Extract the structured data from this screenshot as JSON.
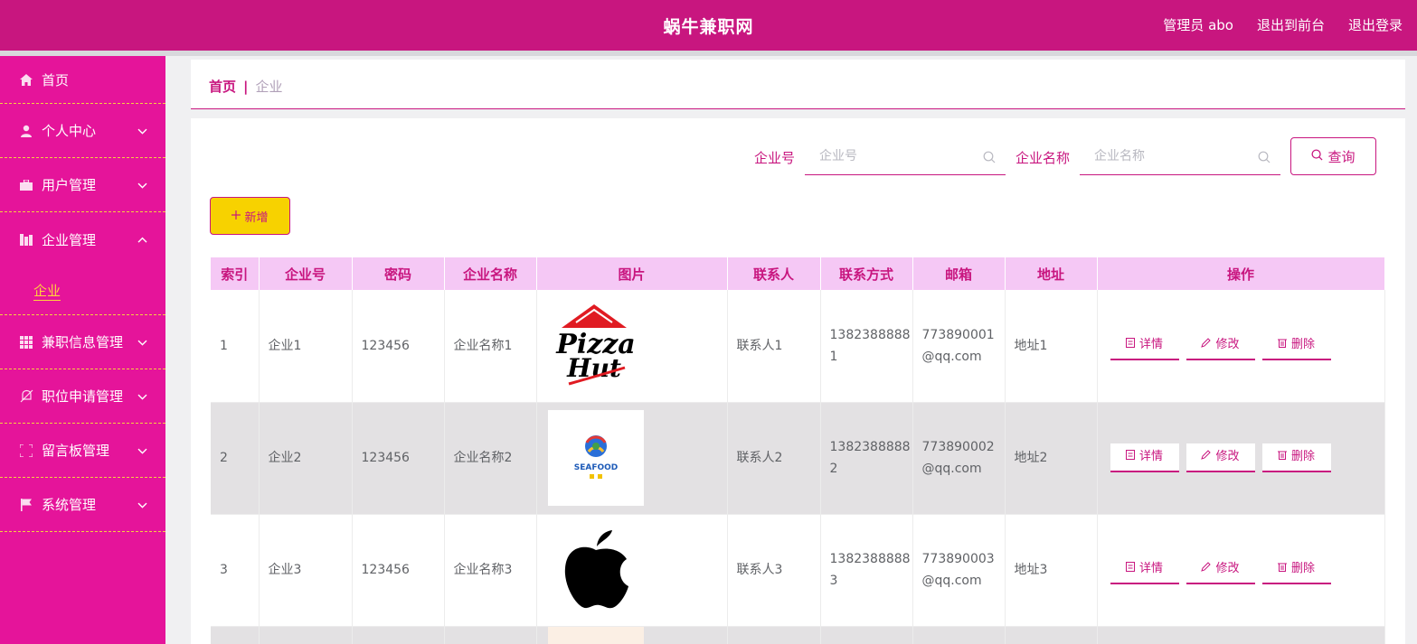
{
  "header": {
    "title": "蜗牛兼职网",
    "admin_label": "管理员 abo",
    "to_front": "退出到前台",
    "logout": "退出登录"
  },
  "sidebar": {
    "items": [
      {
        "label": "首页",
        "icon": "home-icon"
      },
      {
        "label": "个人中心",
        "icon": "user-icon"
      },
      {
        "label": "用户管理",
        "icon": "briefcase-icon"
      },
      {
        "label": "企业管理",
        "icon": "building-icon"
      },
      {
        "label": "兼职信息管理",
        "icon": "grid-icon"
      },
      {
        "label": "职位申请管理",
        "icon": "bell-off-icon"
      },
      {
        "label": "留言板管理",
        "icon": "frame-icon"
      },
      {
        "label": "系统管理",
        "icon": "flag-icon"
      }
    ],
    "sub_item": "企业"
  },
  "breadcrumb": {
    "home": "首页",
    "separator": "|",
    "current": "企业"
  },
  "search": {
    "field1_label": "企业号",
    "field1_placeholder": "企业号",
    "field2_label": "企业名称",
    "field2_placeholder": "企业名称",
    "query_label": "查询"
  },
  "add_label": "新增",
  "table": {
    "headers": [
      "索引",
      "企业号",
      "密码",
      "企业名称",
      "图片",
      "联系人",
      "联系方式",
      "邮箱",
      "地址",
      "操作"
    ],
    "rows": [
      {
        "index": "1",
        "code": "企业1",
        "password": "123456",
        "name": "企业名称1",
        "image": "pizza-hut-logo",
        "contact": "联系人1",
        "phone": "13823888881",
        "email": "773890001@qq.com",
        "address": "地址1"
      },
      {
        "index": "2",
        "code": "企业2",
        "password": "123456",
        "name": "企业名称2",
        "image": "seafood-logo",
        "contact": "联系人2",
        "phone": "13823888882",
        "email": "773890002@qq.com",
        "address": "地址2"
      },
      {
        "index": "3",
        "code": "企业3",
        "password": "123456",
        "name": "企业名称3",
        "image": "apple-logo",
        "contact": "联系人3",
        "phone": "13823888883",
        "email": "773890003@qq.com",
        "address": "地址3"
      }
    ],
    "actions": {
      "detail": "详情",
      "edit": "修改",
      "delete": "删除"
    }
  },
  "logo_text": {
    "pizza_line1": "Pizza",
    "pizza_line2": "Hut",
    "seafood": "SEAFOOD"
  },
  "colors": {
    "primary": "#c8167f",
    "sidebar": "#e5149a",
    "accent_yellow": "#f7d200",
    "table_header": "#f5c8f5"
  }
}
